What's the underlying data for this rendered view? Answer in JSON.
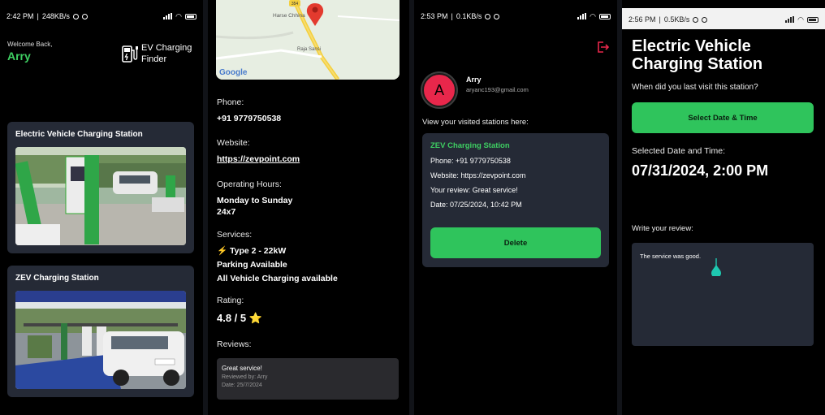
{
  "screen1": {
    "status": {
      "time": "2:42 PM",
      "speed": "248KB/s",
      "battery": "86"
    },
    "welcome": "Welcome Back,",
    "user": "Arry",
    "app_name_line1": "EV Charging",
    "app_name_line2": "Finder",
    "stations": [
      {
        "name": "Electric Vehicle Charging Station"
      },
      {
        "name": "ZEV Charging Station"
      }
    ]
  },
  "screen2": {
    "map": {
      "place1": "Harse Chhina",
      "place2": "Raja Sansi",
      "badge": "354",
      "attribution": "Google"
    },
    "phone_label": "Phone:",
    "phone": "+91 9779750538",
    "website_label": "Website:",
    "website": "https://zevpoint.com",
    "hours_label": "Operating Hours:",
    "hours_line1": "Monday to Sunday",
    "hours_line2": "24x7",
    "services_label": "Services:",
    "service1": "⚡ Type 2 - 22kW",
    "service2": "Parking Available",
    "service3": "All Vehicle Charging available",
    "rating_label": "Rating:",
    "rating": "4.8 / 5 ⭐",
    "reviews_label": "Reviews:",
    "review": {
      "text": "Great service!",
      "by": "Reviewed by: Arry",
      "date": "Date: 25/7/2024"
    }
  },
  "screen3": {
    "status": {
      "time": "2:53 PM",
      "speed": "0.1KB/s",
      "battery": "85"
    },
    "avatar_letter": "A",
    "name": "Arry",
    "email": "aryanc193@gmail.com",
    "visited_label": "View your visited stations here:",
    "visit": {
      "title": "ZEV Charging Station",
      "phone": "Phone: +91 9779750538",
      "website": "Website: https://zevpoint.com",
      "review": "Your review: Great service!",
      "date": "Date: 07/25/2024, 10:42 PM",
      "delete": "Delete"
    }
  },
  "screen4": {
    "status": {
      "time": "2:56 PM",
      "speed": "0.5KB/s",
      "battery": "85"
    },
    "title_line1": "Electric Vehicle",
    "title_line2": "Charging Station",
    "question": "When did you last visit this station?",
    "button": "Select Date & Time",
    "selected_label": "Selected Date and Time:",
    "selected_value": "07/31/2024, 2:00 PM",
    "write_label": "Write your review:",
    "review_text": "The service was good."
  },
  "colors": {
    "accent": "#2fc45c",
    "green_text": "#3ecf62",
    "card": "#252a36",
    "avatar": "#e8274b",
    "logout": "#e8274b"
  }
}
